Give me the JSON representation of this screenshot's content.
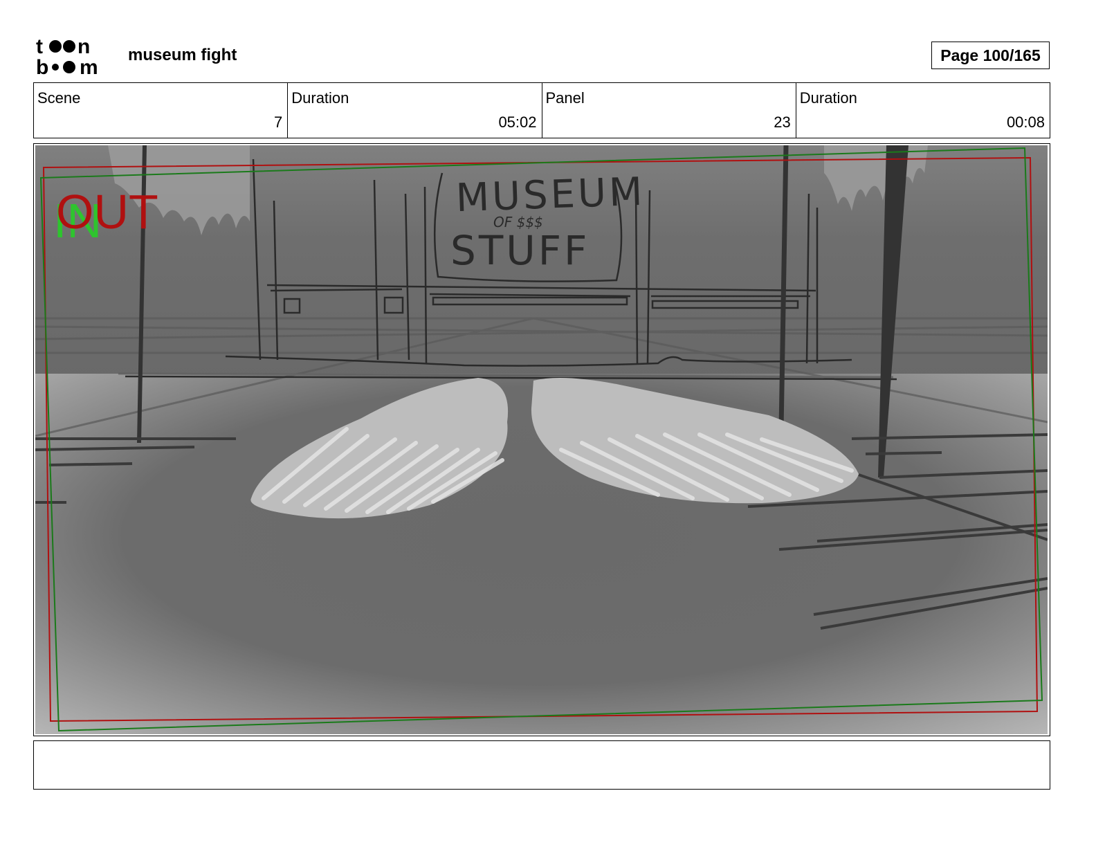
{
  "header": {
    "logo_text": "toon boom",
    "project_title": "museum fight",
    "page_label": "Page 100/165"
  },
  "info": {
    "scene_label": "Scene",
    "scene_value": "7",
    "scene_duration_label": "Duration",
    "scene_duration_value": "05:02",
    "panel_label": "Panel",
    "panel_value": "23",
    "panel_duration_label": "Duration",
    "panel_duration_value": "00:08"
  },
  "panel": {
    "sign_line1": "MUSEUM",
    "sign_line2": "OF $$$",
    "sign_line3": "STUFF",
    "camera_out_label": "OUT",
    "camera_in_label": "IN",
    "colors": {
      "out_frame": "#b01010",
      "in_frame": "#1a7a1a",
      "in_text": "#2ec42e"
    }
  },
  "notes": {
    "text": ""
  }
}
